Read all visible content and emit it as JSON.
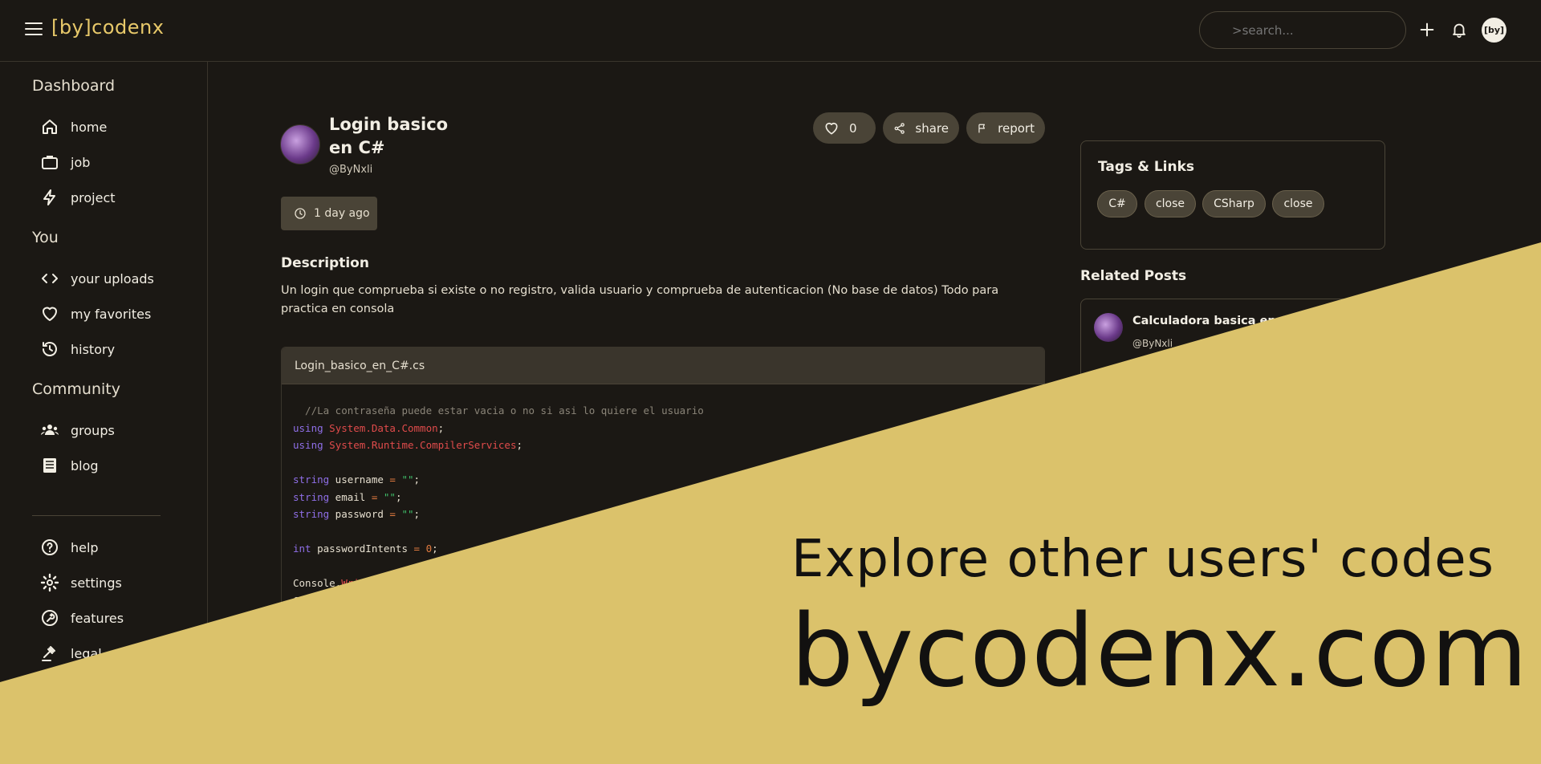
{
  "app": {
    "logo": "[by]codenx"
  },
  "header": {
    "search_placeholder": ">search...",
    "avatar_text": "[by]"
  },
  "sidebar": {
    "sections": [
      {
        "title": "Dashboard",
        "items": [
          {
            "label": "home",
            "icon": "home-icon"
          },
          {
            "label": "job",
            "icon": "briefcase-icon"
          },
          {
            "label": "project",
            "icon": "bolt-icon"
          }
        ]
      },
      {
        "title": "You",
        "items": [
          {
            "label": "your uploads",
            "icon": "code-icon"
          },
          {
            "label": "my favorites",
            "icon": "heart-icon"
          },
          {
            "label": "history",
            "icon": "history-icon"
          }
        ]
      },
      {
        "title": "Community",
        "items": [
          {
            "label": "groups",
            "icon": "groups-icon"
          },
          {
            "label": "blog",
            "icon": "blog-icon"
          }
        ]
      }
    ],
    "bottom_items": [
      {
        "label": "help",
        "icon": "help-icon"
      },
      {
        "label": "settings",
        "icon": "gear-icon"
      },
      {
        "label": "features",
        "icon": "wrench-icon"
      },
      {
        "label": "legal",
        "icon": "gavel-icon"
      }
    ]
  },
  "post": {
    "title": "Login basico en C#",
    "user": "@ByNxli",
    "likes": "0",
    "share_label": "share",
    "report_label": "report",
    "time": "1 day ago",
    "description_title": "Description",
    "description": "Un login que comprueba si existe o no registro, valida usuario y comprueba de autenticacion (No base de datos) Todo para practica en consola",
    "filename": "Login_basico_en_C#.cs"
  },
  "tags_card": {
    "title": "Tags & Links",
    "tags": [
      "C#",
      "close",
      "CSharp",
      "close"
    ]
  },
  "related": {
    "title": "Related Posts",
    "items": [
      {
        "title": "Calculadora basica en C#",
        "user": "@ByNxli"
      }
    ]
  },
  "promo": {
    "subtitle": "Explore other users' codes",
    "domain": "bycodenx.com"
  },
  "colors": {
    "accent": "#e8c96a",
    "background": "#1b1814",
    "promo_bg": "#dbc26b",
    "chip": "#4a4437"
  }
}
